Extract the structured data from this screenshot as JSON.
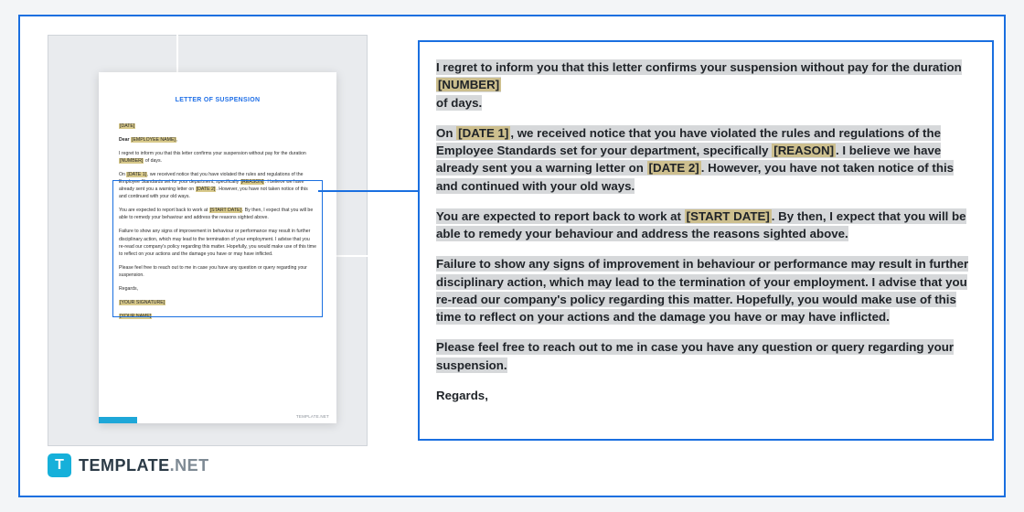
{
  "brand": {
    "badge": "T",
    "name": "TEMPLATE",
    "suffix": ".NET",
    "page_brand": "TEMPLATE.NET"
  },
  "thumb": {
    "title": "LETTER OF SUSPENSION",
    "date_label": "[DATE]",
    "greeting_prefix": "Dear",
    "greeting_ph": "[EMPLOYEE NAME]",
    "sig1": "[YOUR SIGNATURE]",
    "sig2": "[YOUR NAME]"
  },
  "body": {
    "p1a": "I regret to inform you that this letter confirms your suspension without pay for the duration ",
    "p1_ph": "[NUMBER]",
    "p1b": " of days.",
    "p2a": "On ",
    "p2_ph1": "[DATE 1]",
    "p2b": ", we received notice that you have violated the rules and regulations of the Employee Standards set for your department, specifically ",
    "p2_ph2": "[REASON]",
    "p2c": ". I believe we have already sent you a warning letter on ",
    "p2_ph3": "[DATE 2]",
    "p2d": ". However, you have not taken notice of this and continued with your old ways.",
    "p3a": "You are expected to report back to work at ",
    "p3_ph": "[START DATE]",
    "p3b": ". By then, I expect that you will be able to remedy your behaviour and address the reasons sighted above.",
    "p4": "Failure to show any signs of improvement in behaviour or performance may result in further disciplinary action, which may lead to the termination of your employment. I advise that you re-read our company's policy regarding this matter. Hopefully, you would make use of this time to reflect on your actions and the damage you have or may have inflicted.",
    "p5": "Please feel free to reach out to me in case you have any question or query regarding your suspension.",
    "regards": "Regards,"
  }
}
